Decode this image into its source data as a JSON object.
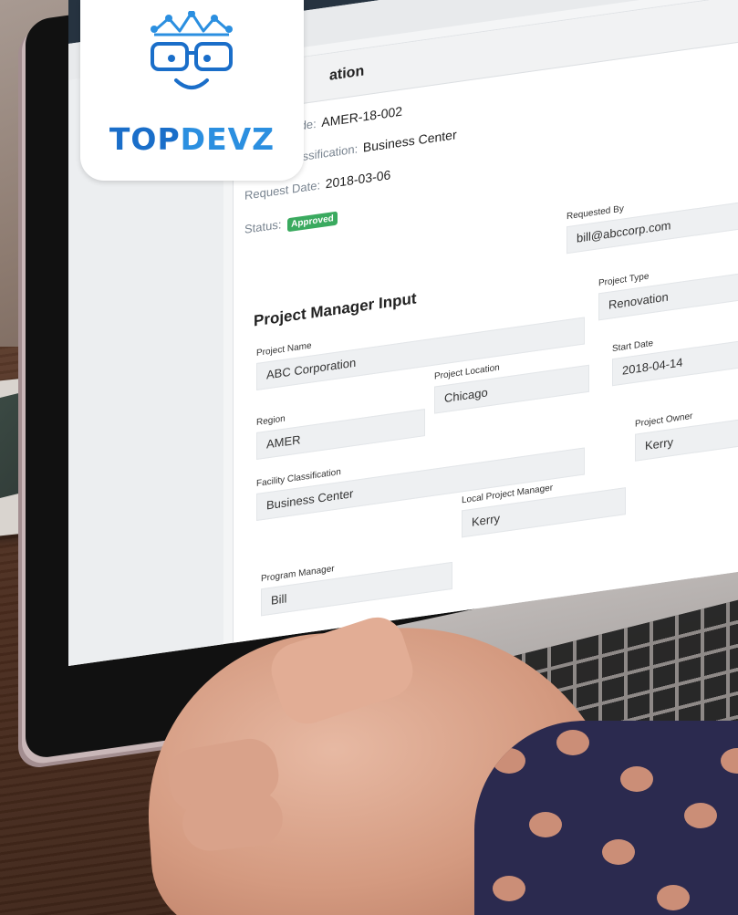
{
  "logo": {
    "part1": "TOP",
    "part2": "DEVZ"
  },
  "app": {
    "card_title": "ation",
    "project_code_label": "Project Code:",
    "project_code": "AMER-18-002",
    "facility_label": "Facility Classification:",
    "facility": "Business Center",
    "request_date_label": "Request Date:",
    "request_date": "2018-03-06",
    "status_label": "Status:",
    "status": "Approved",
    "section_title": "Project Manager Input",
    "fields": {
      "requested_by": {
        "label": "Requested By",
        "value": "bill@abccorp.com"
      },
      "project_name": {
        "label": "Project Name",
        "value": "ABC Corporation"
      },
      "project_type": {
        "label": "Project Type",
        "value": "Renovation"
      },
      "project_location": {
        "label": "Project Location",
        "value": "Chicago"
      },
      "region": {
        "label": "Region",
        "value": "AMER"
      },
      "start_date": {
        "label": "Start Date",
        "value": "2018-04-14"
      },
      "facility_classification": {
        "label": "Facility Classification",
        "value": "Business Center"
      },
      "project_owner": {
        "label": "Project Owner",
        "value": "Kerry"
      },
      "local_project_manager": {
        "label": "Local Project Manager",
        "value": "Kerry"
      },
      "program_manager": {
        "label": "Program Manager",
        "value": "Bill"
      }
    }
  },
  "colors": {
    "brand_dark": "#1a6ec9",
    "brand_light": "#2b8fe0",
    "approved": "#3aaa5f"
  }
}
